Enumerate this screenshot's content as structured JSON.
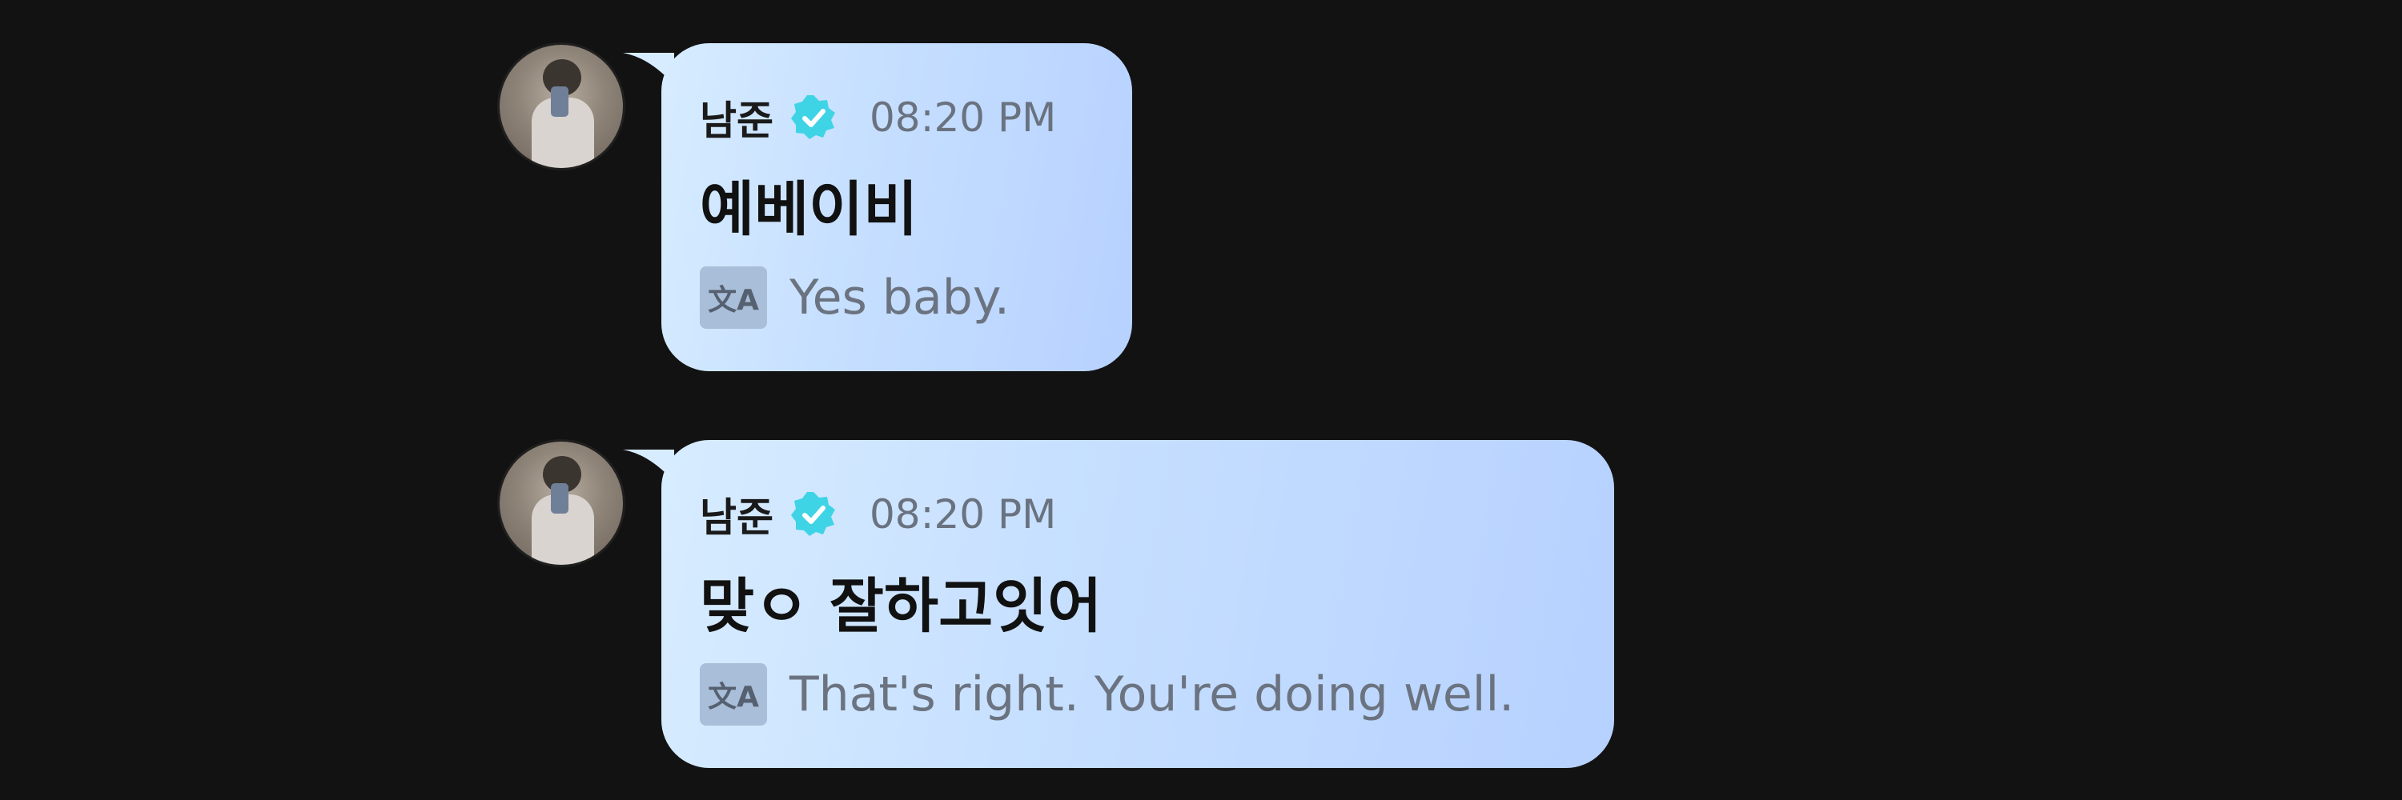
{
  "messages": [
    {
      "sender": "남준",
      "time": "08:20 PM",
      "text": "예베이비",
      "translation": "Yes baby."
    },
    {
      "sender": "남준",
      "time": "08:20 PM",
      "text": "맞ㅇ 잘하고잇어",
      "translation": "That's right. You're doing well."
    }
  ],
  "icons": {
    "verified": "verified-check-icon",
    "translate": "translate-icon"
  },
  "translate_glyph": "文A",
  "colors": {
    "background": "#121212",
    "bubble_start": "#d7ecff",
    "bubble_end": "#b6d1ff",
    "verified_badge": "#3fd3e6",
    "timestamp": "#6a7280"
  }
}
